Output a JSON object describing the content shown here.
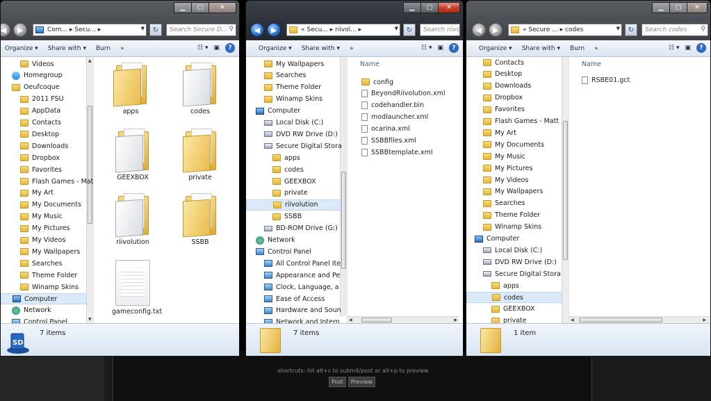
{
  "background": {
    "shortcuts": "shortcuts: hit alt+s to submit/post or alt+p to preview",
    "post_label": "Post",
    "preview_label": "Preview"
  },
  "win1": {
    "address": "Com... ▸ Secu... ▸",
    "search_placeholder": "Search Secure D...",
    "toolbar": [
      "Organize ▾",
      "Share with ▾",
      "Burn",
      "»"
    ],
    "nav": [
      {
        "label": "Videos",
        "icon": "folder"
      },
      {
        "label": "Homegroup",
        "icon": "home"
      },
      {
        "label": "Oeufcoque",
        "icon": "folder"
      },
      {
        "label": "2011 FSU",
        "icon": "folder"
      },
      {
        "label": "AppData",
        "icon": "folder"
      },
      {
        "label": "Contacts",
        "icon": "folder"
      },
      {
        "label": "Desktop",
        "icon": "folder"
      },
      {
        "label": "Downloads",
        "icon": "folder"
      },
      {
        "label": "Dropbox",
        "icon": "folder"
      },
      {
        "label": "Favorites",
        "icon": "folder"
      },
      {
        "label": "Flash Games - Matt",
        "icon": "folder"
      },
      {
        "label": "My Art",
        "icon": "folder"
      },
      {
        "label": "My Documents",
        "icon": "folder"
      },
      {
        "label": "My Music",
        "icon": "folder"
      },
      {
        "label": "My Pictures",
        "icon": "folder"
      },
      {
        "label": "My Videos",
        "icon": "folder"
      },
      {
        "label": "My Wallpapers",
        "icon": "folder"
      },
      {
        "label": "Searches",
        "icon": "folder"
      },
      {
        "label": "Theme Folder",
        "icon": "folder"
      },
      {
        "label": "Winamp Skins",
        "icon": "folder"
      },
      {
        "label": "Computer",
        "icon": "comp",
        "selected": true
      },
      {
        "label": "Network",
        "icon": "net"
      },
      {
        "label": "Control Panel",
        "icon": "ctrl"
      }
    ],
    "items": [
      {
        "label": "apps",
        "type": "folder"
      },
      {
        "label": "codes",
        "type": "white-folder"
      },
      {
        "label": "GEEXBOX",
        "type": "white-folder"
      },
      {
        "label": "private",
        "type": "folder"
      },
      {
        "label": "riivolution",
        "type": "white-folder"
      },
      {
        "label": "SSBB",
        "type": "folder"
      },
      {
        "label": "gameconfig.txt",
        "type": "file"
      }
    ],
    "count": "7 items"
  },
  "win2": {
    "address": "« Secu... ▸ riivol... ▸",
    "search_placeholder": "Search riivo...",
    "toolbar": [
      "Organize ▾",
      "Share with ▾",
      "»"
    ],
    "nav": [
      {
        "label": "My Wallpapers",
        "icon": "folder",
        "indent": 1
      },
      {
        "label": "Searches",
        "icon": "folder",
        "indent": 1
      },
      {
        "label": "Theme Folder",
        "icon": "folder",
        "indent": 1
      },
      {
        "label": "Winamp Skins",
        "icon": "folder",
        "indent": 1
      },
      {
        "label": "Computer",
        "icon": "comp",
        "indent": 0
      },
      {
        "label": "Local Disk (C:)",
        "icon": "drive",
        "indent": 1
      },
      {
        "label": "DVD RW Drive (D:)",
        "icon": "drive",
        "indent": 1
      },
      {
        "label": "Secure Digital Stora",
        "icon": "drive",
        "indent": 1
      },
      {
        "label": "apps",
        "icon": "folder",
        "indent": 2
      },
      {
        "label": "codes",
        "icon": "folder",
        "indent": 2
      },
      {
        "label": "GEEXBOX",
        "icon": "folder",
        "indent": 2
      },
      {
        "label": "private",
        "icon": "folder",
        "indent": 2
      },
      {
        "label": "riivolution",
        "icon": "folder",
        "indent": 2,
        "selected": true
      },
      {
        "label": "SSBB",
        "icon": "folder",
        "indent": 2
      },
      {
        "label": "BD-ROM Drive (G:)",
        "icon": "drive",
        "indent": 1
      },
      {
        "label": "Network",
        "icon": "net",
        "indent": 0
      },
      {
        "label": "Control Panel",
        "icon": "ctrl",
        "indent": 0
      },
      {
        "label": "All Control Panel Ite",
        "icon": "ctrl",
        "indent": 1
      },
      {
        "label": "Appearance and Pe",
        "icon": "ctrl",
        "indent": 1
      },
      {
        "label": "Clock, Language, a",
        "icon": "ctrl",
        "indent": 1
      },
      {
        "label": "Ease of Access",
        "icon": "ctrl",
        "indent": 1
      },
      {
        "label": "Hardware and Soun",
        "icon": "ctrl",
        "indent": 1
      },
      {
        "label": "Network and Intern",
        "icon": "ctrl",
        "indent": 1
      }
    ],
    "column": "Name",
    "items": [
      {
        "label": "config",
        "type": "folder"
      },
      {
        "label": "BeyondRiivolution.xml",
        "type": "file"
      },
      {
        "label": "codehandler.bin",
        "type": "file"
      },
      {
        "label": "modlauncher.xml",
        "type": "file"
      },
      {
        "label": "ocarina.xml",
        "type": "file"
      },
      {
        "label": "SSBBfiles.xml",
        "type": "file"
      },
      {
        "label": "SSBBtemplate.xml",
        "type": "file"
      }
    ],
    "count": "7 items"
  },
  "win3": {
    "address": "« Secure ... ▸ codes",
    "search_placeholder": "Search codes",
    "toolbar": [
      "Organize ▾",
      "Share with ▾",
      "Burn",
      "»"
    ],
    "nav": [
      {
        "label": "Contacts",
        "icon": "folder",
        "indent": 1
      },
      {
        "label": "Desktop",
        "icon": "folder",
        "indent": 1
      },
      {
        "label": "Downloads",
        "icon": "folder",
        "indent": 1
      },
      {
        "label": "Dropbox",
        "icon": "folder",
        "indent": 1
      },
      {
        "label": "Favorites",
        "icon": "folder",
        "indent": 1
      },
      {
        "label": "Flash Games - Matt",
        "icon": "folder",
        "indent": 1
      },
      {
        "label": "My Art",
        "icon": "folder",
        "indent": 1
      },
      {
        "label": "My Documents",
        "icon": "folder",
        "indent": 1
      },
      {
        "label": "My Music",
        "icon": "folder",
        "indent": 1
      },
      {
        "label": "My Pictures",
        "icon": "folder",
        "indent": 1
      },
      {
        "label": "My Videos",
        "icon": "folder",
        "indent": 1
      },
      {
        "label": "My Wallpapers",
        "icon": "folder",
        "indent": 1
      },
      {
        "label": "Searches",
        "icon": "folder",
        "indent": 1
      },
      {
        "label": "Theme Folder",
        "icon": "folder",
        "indent": 1
      },
      {
        "label": "Winamp Skins",
        "icon": "folder",
        "indent": 1
      },
      {
        "label": "Computer",
        "icon": "comp",
        "indent": 0
      },
      {
        "label": "Local Disk (C:)",
        "icon": "drive",
        "indent": 1
      },
      {
        "label": "DVD RW Drive (D:)",
        "icon": "drive",
        "indent": 1
      },
      {
        "label": "Secure Digital Stora",
        "icon": "drive",
        "indent": 1
      },
      {
        "label": "apps",
        "icon": "folder",
        "indent": 2
      },
      {
        "label": "codes",
        "icon": "folder",
        "indent": 2,
        "selected": true
      },
      {
        "label": "GEEXBOX",
        "icon": "folder",
        "indent": 2
      },
      {
        "label": "private",
        "icon": "folder",
        "indent": 2
      }
    ],
    "column": "Name",
    "items": [
      {
        "label": "RSBE01.gct",
        "type": "file"
      }
    ],
    "count": "1 item"
  }
}
